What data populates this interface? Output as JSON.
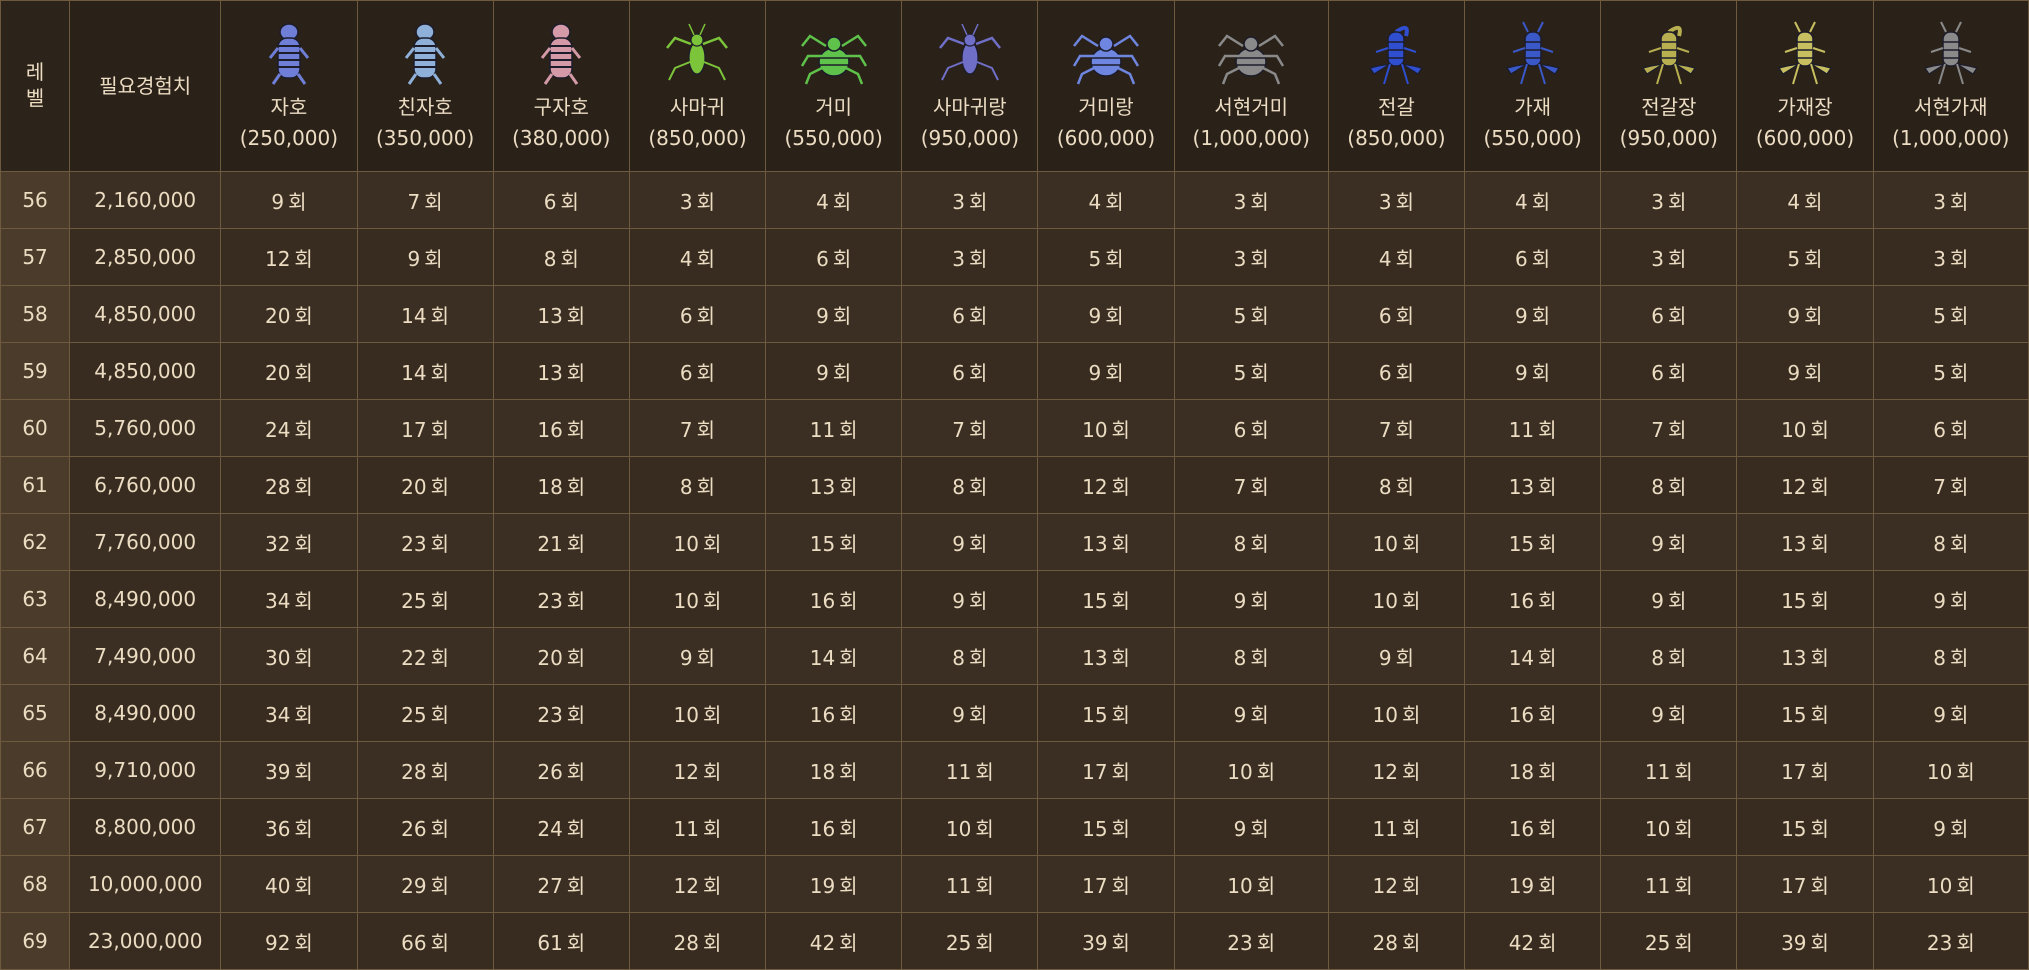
{
  "header": {
    "level_label_1": "레",
    "level_label_2": "벨",
    "exp_label": "필요경험치",
    "monsters": [
      {
        "name": "자호",
        "exp": "(250,000)",
        "icon": "blue-tiger-icon",
        "color": "#6f7fd8"
      },
      {
        "name": "친자호",
        "exp": "(350,000)",
        "icon": "lightblue-tiger-icon",
        "color": "#8fb0d8"
      },
      {
        "name": "구자호",
        "exp": "(380,000)",
        "icon": "pink-tiger-icon",
        "color": "#d49aa8"
      },
      {
        "name": "사마귀",
        "exp": "(850,000)",
        "icon": "green-mantis-icon",
        "color": "#7cc43a"
      },
      {
        "name": "거미",
        "exp": "(550,000)",
        "icon": "green-spider-icon",
        "color": "#5fc24a"
      },
      {
        "name": "사마귀랑",
        "exp": "(950,000)",
        "icon": "purple-mantis-icon",
        "color": "#6f6fc8"
      },
      {
        "name": "거미랑",
        "exp": "(600,000)",
        "icon": "blue-spider-icon",
        "color": "#6f86e0"
      },
      {
        "name": "서현거미",
        "exp": "(1,000,000)",
        "icon": "gray-spider-icon",
        "color": "#8a8a8a"
      },
      {
        "name": "전갈",
        "exp": "(850,000)",
        "icon": "blue-scorpion-icon",
        "color": "#2f4fd0"
      },
      {
        "name": "가재",
        "exp": "(550,000)",
        "icon": "blue-crayfish-icon",
        "color": "#3a58c8"
      },
      {
        "name": "전갈장",
        "exp": "(950,000)",
        "icon": "yellow-scorpion-icon",
        "color": "#b8b050"
      },
      {
        "name": "가재장",
        "exp": "(600,000)",
        "icon": "yellow-crayfish-icon",
        "color": "#c8c060"
      },
      {
        "name": "서현가재",
        "exp": "(1,000,000)",
        "icon": "gray-crayfish-icon",
        "color": "#8a8a8a"
      }
    ]
  },
  "unit": "회",
  "rows": [
    {
      "level": "56",
      "exp": "2,160,000",
      "counts": [
        "9",
        "7",
        "6",
        "3",
        "4",
        "3",
        "4",
        "3",
        "3",
        "4",
        "3",
        "4",
        "3"
      ]
    },
    {
      "level": "57",
      "exp": "2,850,000",
      "counts": [
        "12",
        "9",
        "8",
        "4",
        "6",
        "3",
        "5",
        "3",
        "4",
        "6",
        "3",
        "5",
        "3"
      ]
    },
    {
      "level": "58",
      "exp": "4,850,000",
      "counts": [
        "20",
        "14",
        "13",
        "6",
        "9",
        "6",
        "9",
        "5",
        "6",
        "9",
        "6",
        "9",
        "5"
      ]
    },
    {
      "level": "59",
      "exp": "4,850,000",
      "counts": [
        "20",
        "14",
        "13",
        "6",
        "9",
        "6",
        "9",
        "5",
        "6",
        "9",
        "6",
        "9",
        "5"
      ]
    },
    {
      "level": "60",
      "exp": "5,760,000",
      "counts": [
        "24",
        "17",
        "16",
        "7",
        "11",
        "7",
        "10",
        "6",
        "7",
        "11",
        "7",
        "10",
        "6"
      ]
    },
    {
      "level": "61",
      "exp": "6,760,000",
      "counts": [
        "28",
        "20",
        "18",
        "8",
        "13",
        "8",
        "12",
        "7",
        "8",
        "13",
        "8",
        "12",
        "7"
      ]
    },
    {
      "level": "62",
      "exp": "7,760,000",
      "counts": [
        "32",
        "23",
        "21",
        "10",
        "15",
        "9",
        "13",
        "8",
        "10",
        "15",
        "9",
        "13",
        "8"
      ]
    },
    {
      "level": "63",
      "exp": "8,490,000",
      "counts": [
        "34",
        "25",
        "23",
        "10",
        "16",
        "9",
        "15",
        "9",
        "10",
        "16",
        "9",
        "15",
        "9"
      ]
    },
    {
      "level": "64",
      "exp": "7,490,000",
      "counts": [
        "30",
        "22",
        "20",
        "9",
        "14",
        "8",
        "13",
        "8",
        "9",
        "14",
        "8",
        "13",
        "8"
      ]
    },
    {
      "level": "65",
      "exp": "8,490,000",
      "counts": [
        "34",
        "25",
        "23",
        "10",
        "16",
        "9",
        "15",
        "9",
        "10",
        "16",
        "9",
        "15",
        "9"
      ]
    },
    {
      "level": "66",
      "exp": "9,710,000",
      "counts": [
        "39",
        "28",
        "26",
        "12",
        "18",
        "11",
        "17",
        "10",
        "12",
        "18",
        "11",
        "17",
        "10"
      ]
    },
    {
      "level": "67",
      "exp": "8,800,000",
      "counts": [
        "36",
        "26",
        "24",
        "11",
        "16",
        "10",
        "15",
        "9",
        "11",
        "16",
        "10",
        "15",
        "9"
      ]
    },
    {
      "level": "68",
      "exp": "10,000,000",
      "counts": [
        "40",
        "29",
        "27",
        "12",
        "19",
        "11",
        "17",
        "10",
        "12",
        "19",
        "11",
        "17",
        "10"
      ]
    },
    {
      "level": "69",
      "exp": "23,000,000",
      "counts": [
        "92",
        "66",
        "61",
        "28",
        "42",
        "25",
        "39",
        "23",
        "28",
        "42",
        "25",
        "39",
        "23"
      ]
    }
  ]
}
